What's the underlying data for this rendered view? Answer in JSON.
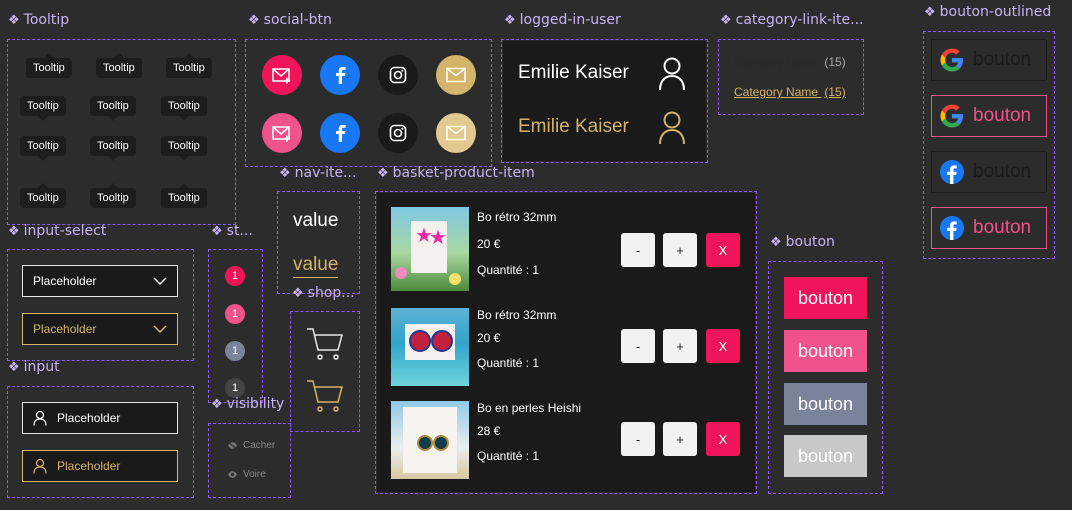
{
  "titles": {
    "tooltip": "Tooltip",
    "social": "social-btn",
    "logged_user": "logged-in-user",
    "category": "category-link-ite...",
    "bouton_outlined": "bouton-outlined",
    "input_select": "input-select",
    "st": "st...",
    "nav_item": "nav-ite...",
    "basket": "basket-product-item",
    "bouton": "bouton",
    "input": "input",
    "visibility": "visibility",
    "shop": "shop..."
  },
  "tooltip_label": "Tooltip",
  "logged_user": {
    "name": "Emilie Kaiser"
  },
  "category": {
    "name": "Category Name",
    "count": "(15)"
  },
  "bouton_label": "bouton",
  "input_select": {
    "placeholder": "Placeholder"
  },
  "input": {
    "placeholder": "Placeholder"
  },
  "badges": [
    "1",
    "1",
    "1",
    "1"
  ],
  "visibility": {
    "hide": "Cacher",
    "show": "Voire"
  },
  "nav_item": {
    "value": "value"
  },
  "basket": {
    "items": [
      {
        "name": "Bo rétro 32mm",
        "price": "20 €",
        "qty": "Quantité : 1"
      },
      {
        "name": "Bo rétro 32mm",
        "price": "20 €",
        "qty": "Quantité : 1"
      },
      {
        "name": "Bo en perles Heishi",
        "price": "28 €",
        "qty": "Quantité : 1"
      }
    ],
    "minus": "-",
    "plus": "+",
    "remove": "X"
  },
  "colors": {
    "accent_pink": "#f0145a",
    "pink_light": "#f0528a",
    "gold": "#d4b36a",
    "slate": "#7a8399",
    "grey": "#c8c8c8",
    "facebook": "#1877f2",
    "frame_purple": "#8b5cf6"
  },
  "icons": [
    "mail-sparkle-icon",
    "facebook-icon",
    "instagram-icon",
    "mail-icon",
    "user-icon",
    "google-icon",
    "cart-icon",
    "chevron-down-icon",
    "eye-off-icon",
    "eye-icon"
  ]
}
